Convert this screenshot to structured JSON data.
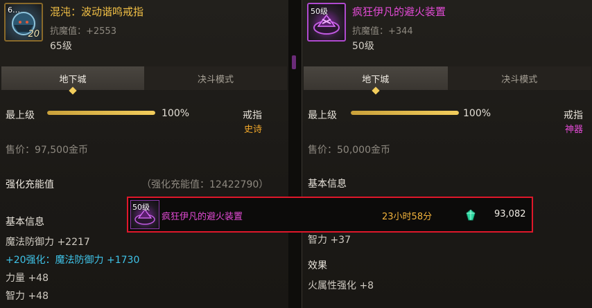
{
  "left": {
    "icon": {
      "corner_label": "6…",
      "number": "20"
    },
    "name": "混沌：波动谐鸣戒指",
    "magic_resist": "抗魔值：+2553",
    "level": "65级",
    "tabs": [
      "地下城",
      "决斗模式"
    ],
    "grade_label": "最上级",
    "grade_percent": "100%",
    "grade_value": 1.0,
    "slot_type": "戒指",
    "rarity": "史诗",
    "price": "售价：97,500金币",
    "charge_title": "强化充能值",
    "charge_value": "（强化充能值：12422790）",
    "basic_info_title": "基本信息",
    "attrs": [
      "魔法防御力 +2217",
      "+20强化：魔法防御力 +1730",
      "力量 +48",
      "智力 +48"
    ]
  },
  "right": {
    "icon": {
      "corner_label": "50级"
    },
    "name": "疯狂伊凡的避火装置",
    "magic_resist": "抗魔值：+344",
    "level": "50级",
    "tabs": [
      "地下城",
      "决斗模式"
    ],
    "grade_label": "最上级",
    "grade_percent": "100%",
    "grade_value": 1.0,
    "slot_type": "戒指",
    "rarity": "神器",
    "price": "售价：50,000金币",
    "basic_info_title": "基本信息",
    "attrs_visible": [
      "智力 +37"
    ],
    "effect_title": "效果",
    "effect": "火属性强化 +8"
  },
  "popup": {
    "icon_label": "50级",
    "item_name": "疯狂伊凡的避火装置",
    "time_left": "23小时58分",
    "price": "93,082",
    "gem_icon": "green-gem-icon"
  },
  "colors": {
    "epic": "#f2c046",
    "artifact": "#e34bd6",
    "highlight_border": "#e0172a",
    "enhance_cyan": "#3fc3e8"
  }
}
